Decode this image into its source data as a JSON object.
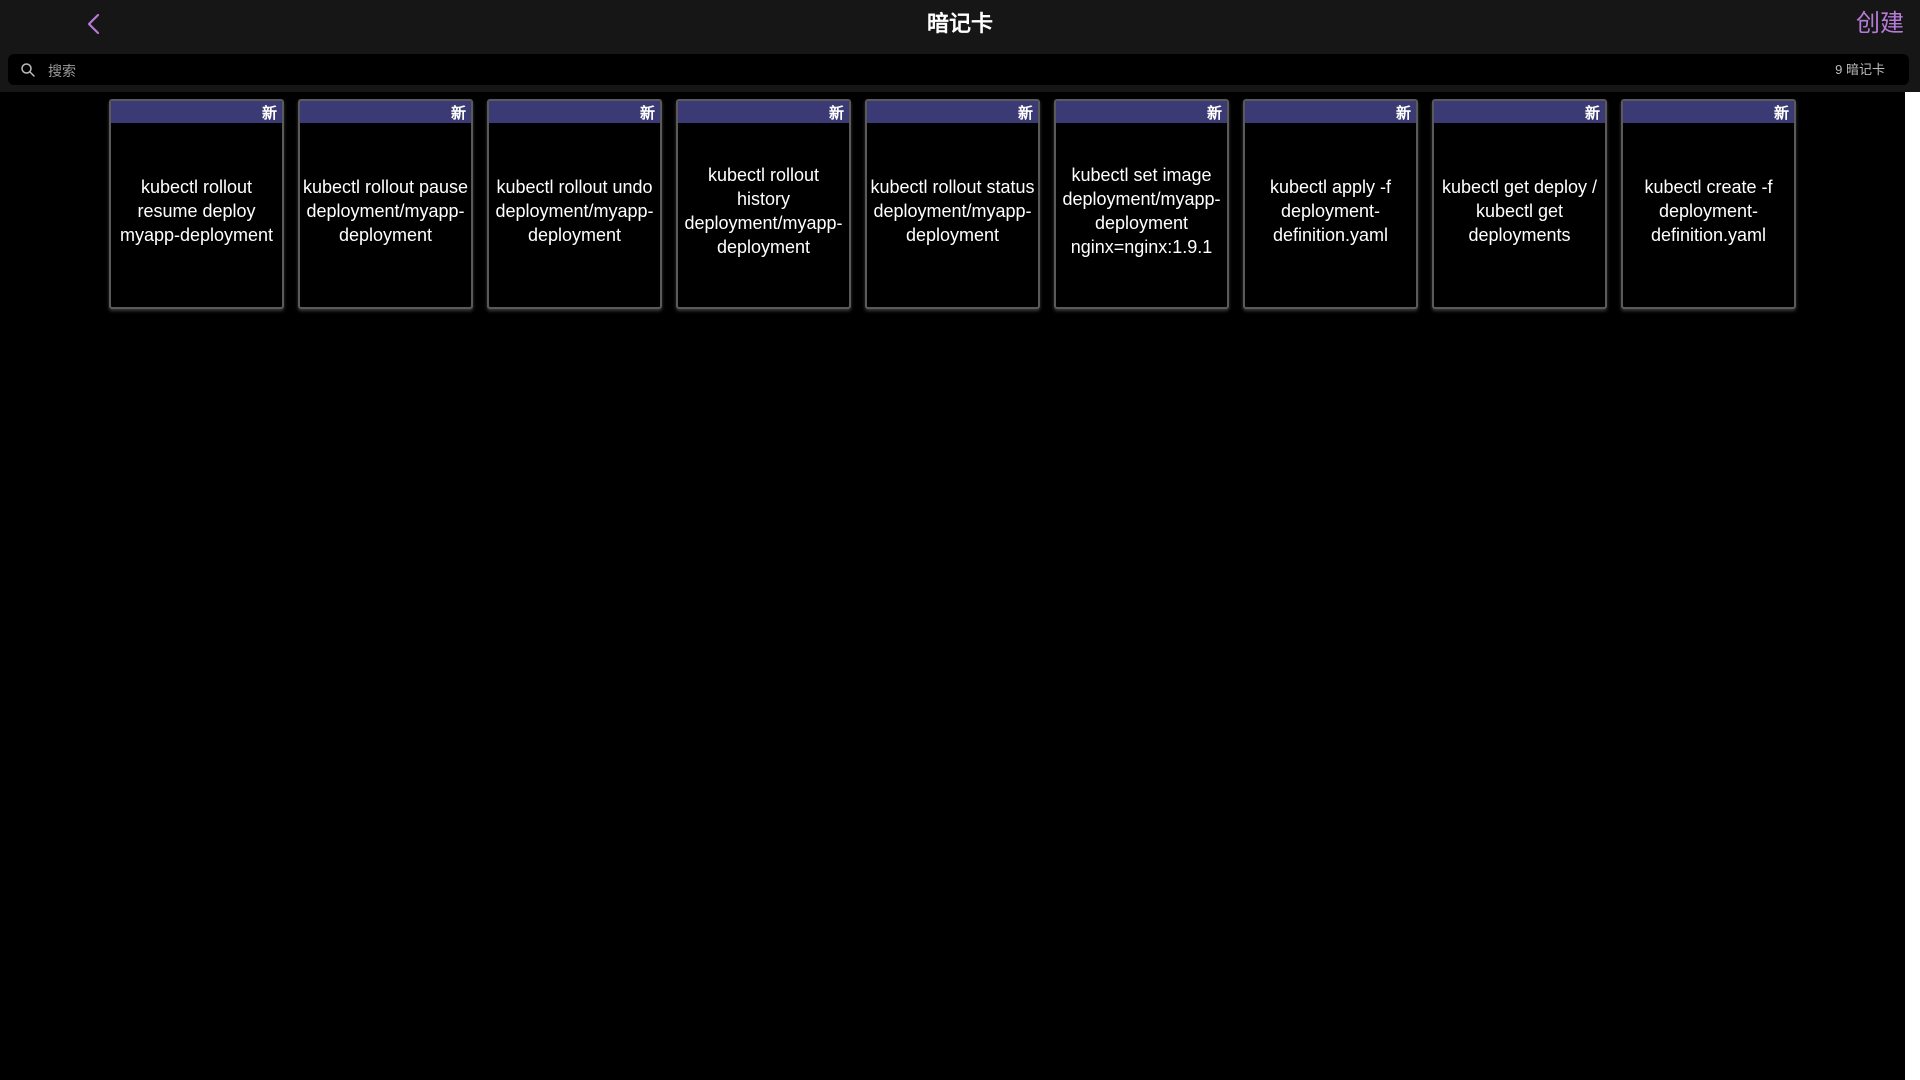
{
  "header": {
    "back_icon": "chevron-left-icon",
    "title": "暗记卡",
    "create_label": "创建"
  },
  "search": {
    "placeholder": "搜索",
    "value": "",
    "icon": "search-icon",
    "count_label": "9 暗记卡"
  },
  "cards": [
    {
      "badge": "新",
      "text": "kubectl rollout resume deploy myapp-deployment"
    },
    {
      "badge": "新",
      "text": "kubectl rollout pause deployment/myapp-deployment"
    },
    {
      "badge": "新",
      "text": "kubectl rollout undo deployment/myapp-deployment"
    },
    {
      "badge": "新",
      "text": "kubectl rollout history deployment/myapp-deployment"
    },
    {
      "badge": "新",
      "text": "kubectl rollout status deployment/myapp-deployment"
    },
    {
      "badge": "新",
      "text": "kubectl set image deployment/myapp-deployment nginx=nginx:1.9.1"
    },
    {
      "badge": "新",
      "text": "kubectl apply -f deployment-definition.yaml"
    },
    {
      "badge": "新",
      "text": "kubectl get deploy / kubectl get deployments"
    },
    {
      "badge": "新",
      "text": "kubectl create -f deployment-definition.yaml"
    }
  ],
  "colors": {
    "accent": "#b57ad6",
    "card_header": "#3b3a74",
    "bar_background": "#161616",
    "page_background": "#000000"
  }
}
